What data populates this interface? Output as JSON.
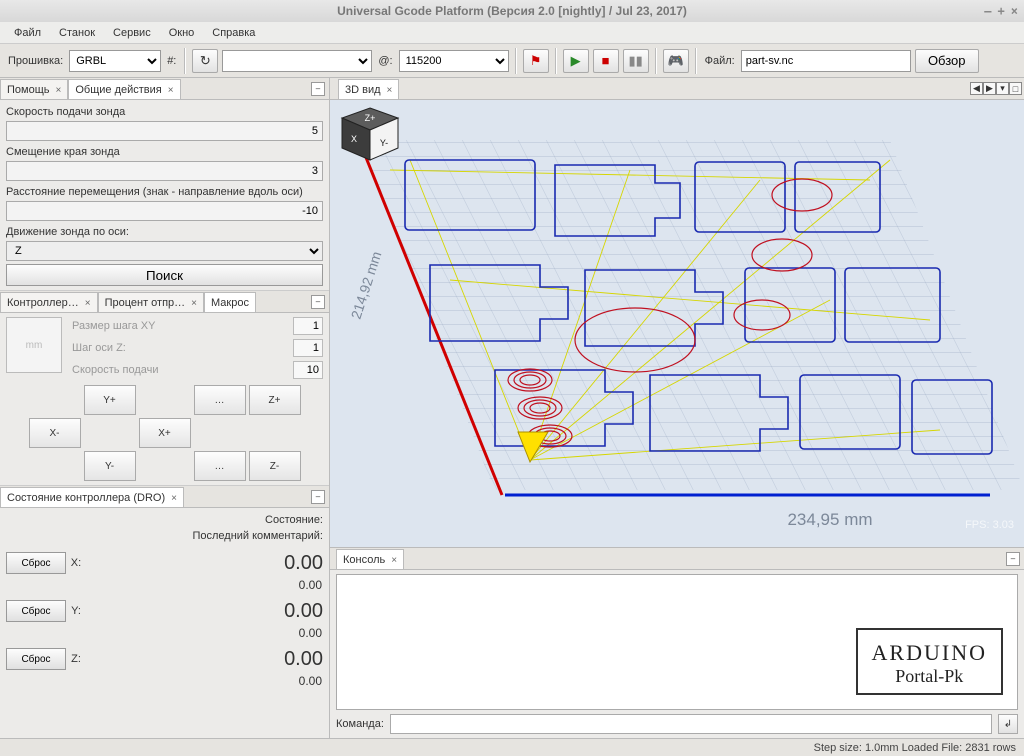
{
  "window": {
    "title": "Universal Gcode Platform (Версия 2.0 [nightly]  / Jul 23, 2017)"
  },
  "menu": {
    "file": "Файл",
    "machine": "Станок",
    "service": "Сервис",
    "window": "Окно",
    "help": "Справка"
  },
  "toolbar": {
    "firmware_label": "Прошивка:",
    "firmware_value": "GRBL",
    "hash_label": "#:",
    "baud_label": "@:",
    "baud_value": "115200",
    "file_label": "Файл:",
    "file_value": "part-sv.nc",
    "browse": "Обзор"
  },
  "left": {
    "tab_help": "Помощь",
    "tab_actions": "Общие действия",
    "probe": {
      "feed_label": "Скорость подачи зонда",
      "feed_value": "5",
      "offset_label": "Смещение края зонда",
      "offset_value": "3",
      "distance_label": "Расстояние перемещения (знак - направление вдоль оси)",
      "distance_value": "-10",
      "axis_label": "Движение зонда по оси:",
      "axis_value": "Z",
      "search": "Поиск"
    },
    "tabs2": {
      "controller": "Контроллер…",
      "percent": "Процент отпр…",
      "macro": "Макрос"
    },
    "jog": {
      "mm": "mm",
      "xy_label": "Размер шага XY",
      "xy_val": "1",
      "z_label": "Шаг оси Z:",
      "z_val": "1",
      "feed_label": "Скорость подачи",
      "feed_val": "10",
      "yplus": "Y+",
      "yminus": "Y-",
      "xplus": "X+",
      "xminus": "X-",
      "zplus": "Z+",
      "zminus": "Z-",
      "dots": "…"
    },
    "dro": {
      "tab": "Состояние контроллера (DRO)",
      "state_label": "Состояние:",
      "comment_label": "Последний комментарий:",
      "reset": "Сброс",
      "x_label": "X:",
      "y_label": "Y:",
      "z_label": "Z:",
      "big": "0.00",
      "small": "0.00"
    }
  },
  "right": {
    "tab_3d": "3D вид",
    "tab_console": "Консоль",
    "cmd_label": "Команда:",
    "dim_x": "234,95 mm",
    "dim_y": "214,92 mm",
    "fps": "FPS: 3.03",
    "cube_zplus": "Z+",
    "cube_yminus": "Y-",
    "cube_x": "X",
    "wm1": "ARDUINO",
    "wm2": "Portal-Pk"
  },
  "status": "Step size: 1.0mm Loaded File: 2831 rows "
}
